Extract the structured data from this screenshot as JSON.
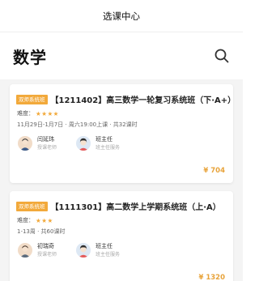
{
  "navbar": {
    "title": "选课中心"
  },
  "header": {
    "title": "数学",
    "search_icon": "search-icon"
  },
  "colors": {
    "accent": "#f2a93b",
    "price": "#e8a33a"
  },
  "courses": [
    {
      "tag": "双师系统班",
      "title": "【1211402】高三数学一轮复习系统班（下·A+）",
      "difficulty_label": "难度：",
      "stars": "★★★★",
      "schedule": "11月29日-1月7日 · 周六19:00上课 · 共32课时",
      "teacher": {
        "name": "闫延玮",
        "role": "授课老师"
      },
      "head_teacher": {
        "name": "班主任",
        "role": "班主任服务"
      },
      "price": "¥ 704"
    },
    {
      "tag": "双师系统班",
      "title": "【1111301】高二数学上学期系统班（上·A）",
      "difficulty_label": "难度：",
      "stars": "★★★",
      "schedule": "1-13周 · 共60课时",
      "teacher": {
        "name": "初瑞奇",
        "role": "授课老师"
      },
      "head_teacher": {
        "name": "班主任",
        "role": "班主任服务"
      },
      "price": "¥ 1320"
    }
  ]
}
